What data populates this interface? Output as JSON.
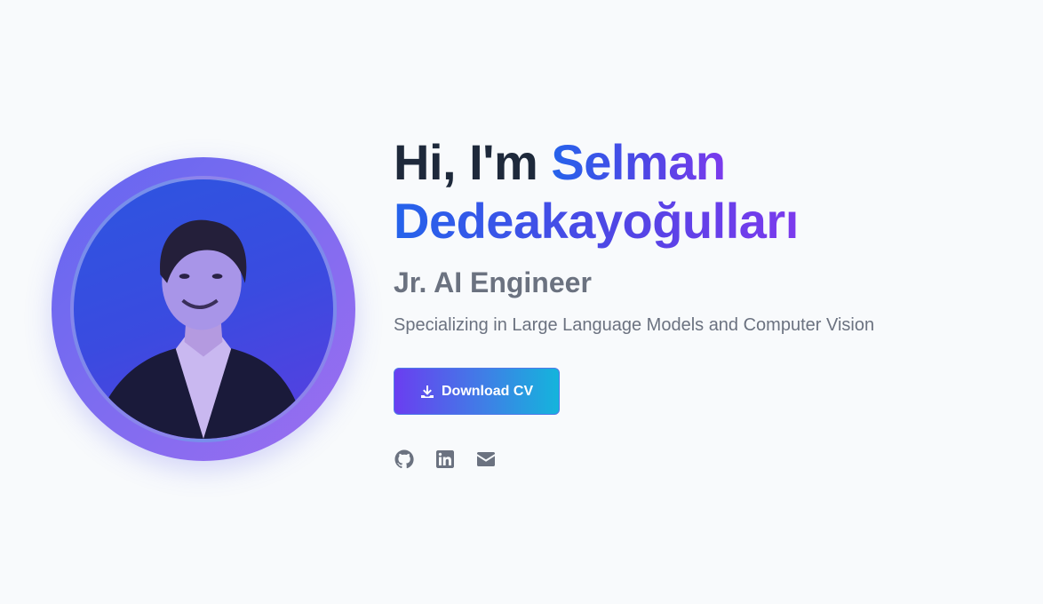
{
  "hero": {
    "greeting": "Hi, I'm ",
    "name_first": "Selman",
    "name_last": "Dedeakayoğulları",
    "role": "Jr. AI Engineer",
    "tagline": "Specializing in Large Language Models and Computer Vision",
    "cv_button_label": "Download CV",
    "avatar_alt": "profile photo"
  },
  "socials": [
    {
      "icon": "github-icon"
    },
    {
      "icon": "linkedin-icon"
    },
    {
      "icon": "mail-icon"
    }
  ],
  "colors": {
    "background": "#f8fafc",
    "heading": "#1e293b",
    "muted": "#6b7280",
    "accent_blue": "#2563eb",
    "accent_purple": "#7c3aed",
    "button_start": "#6a3ef0",
    "button_end": "#14b4dc"
  }
}
